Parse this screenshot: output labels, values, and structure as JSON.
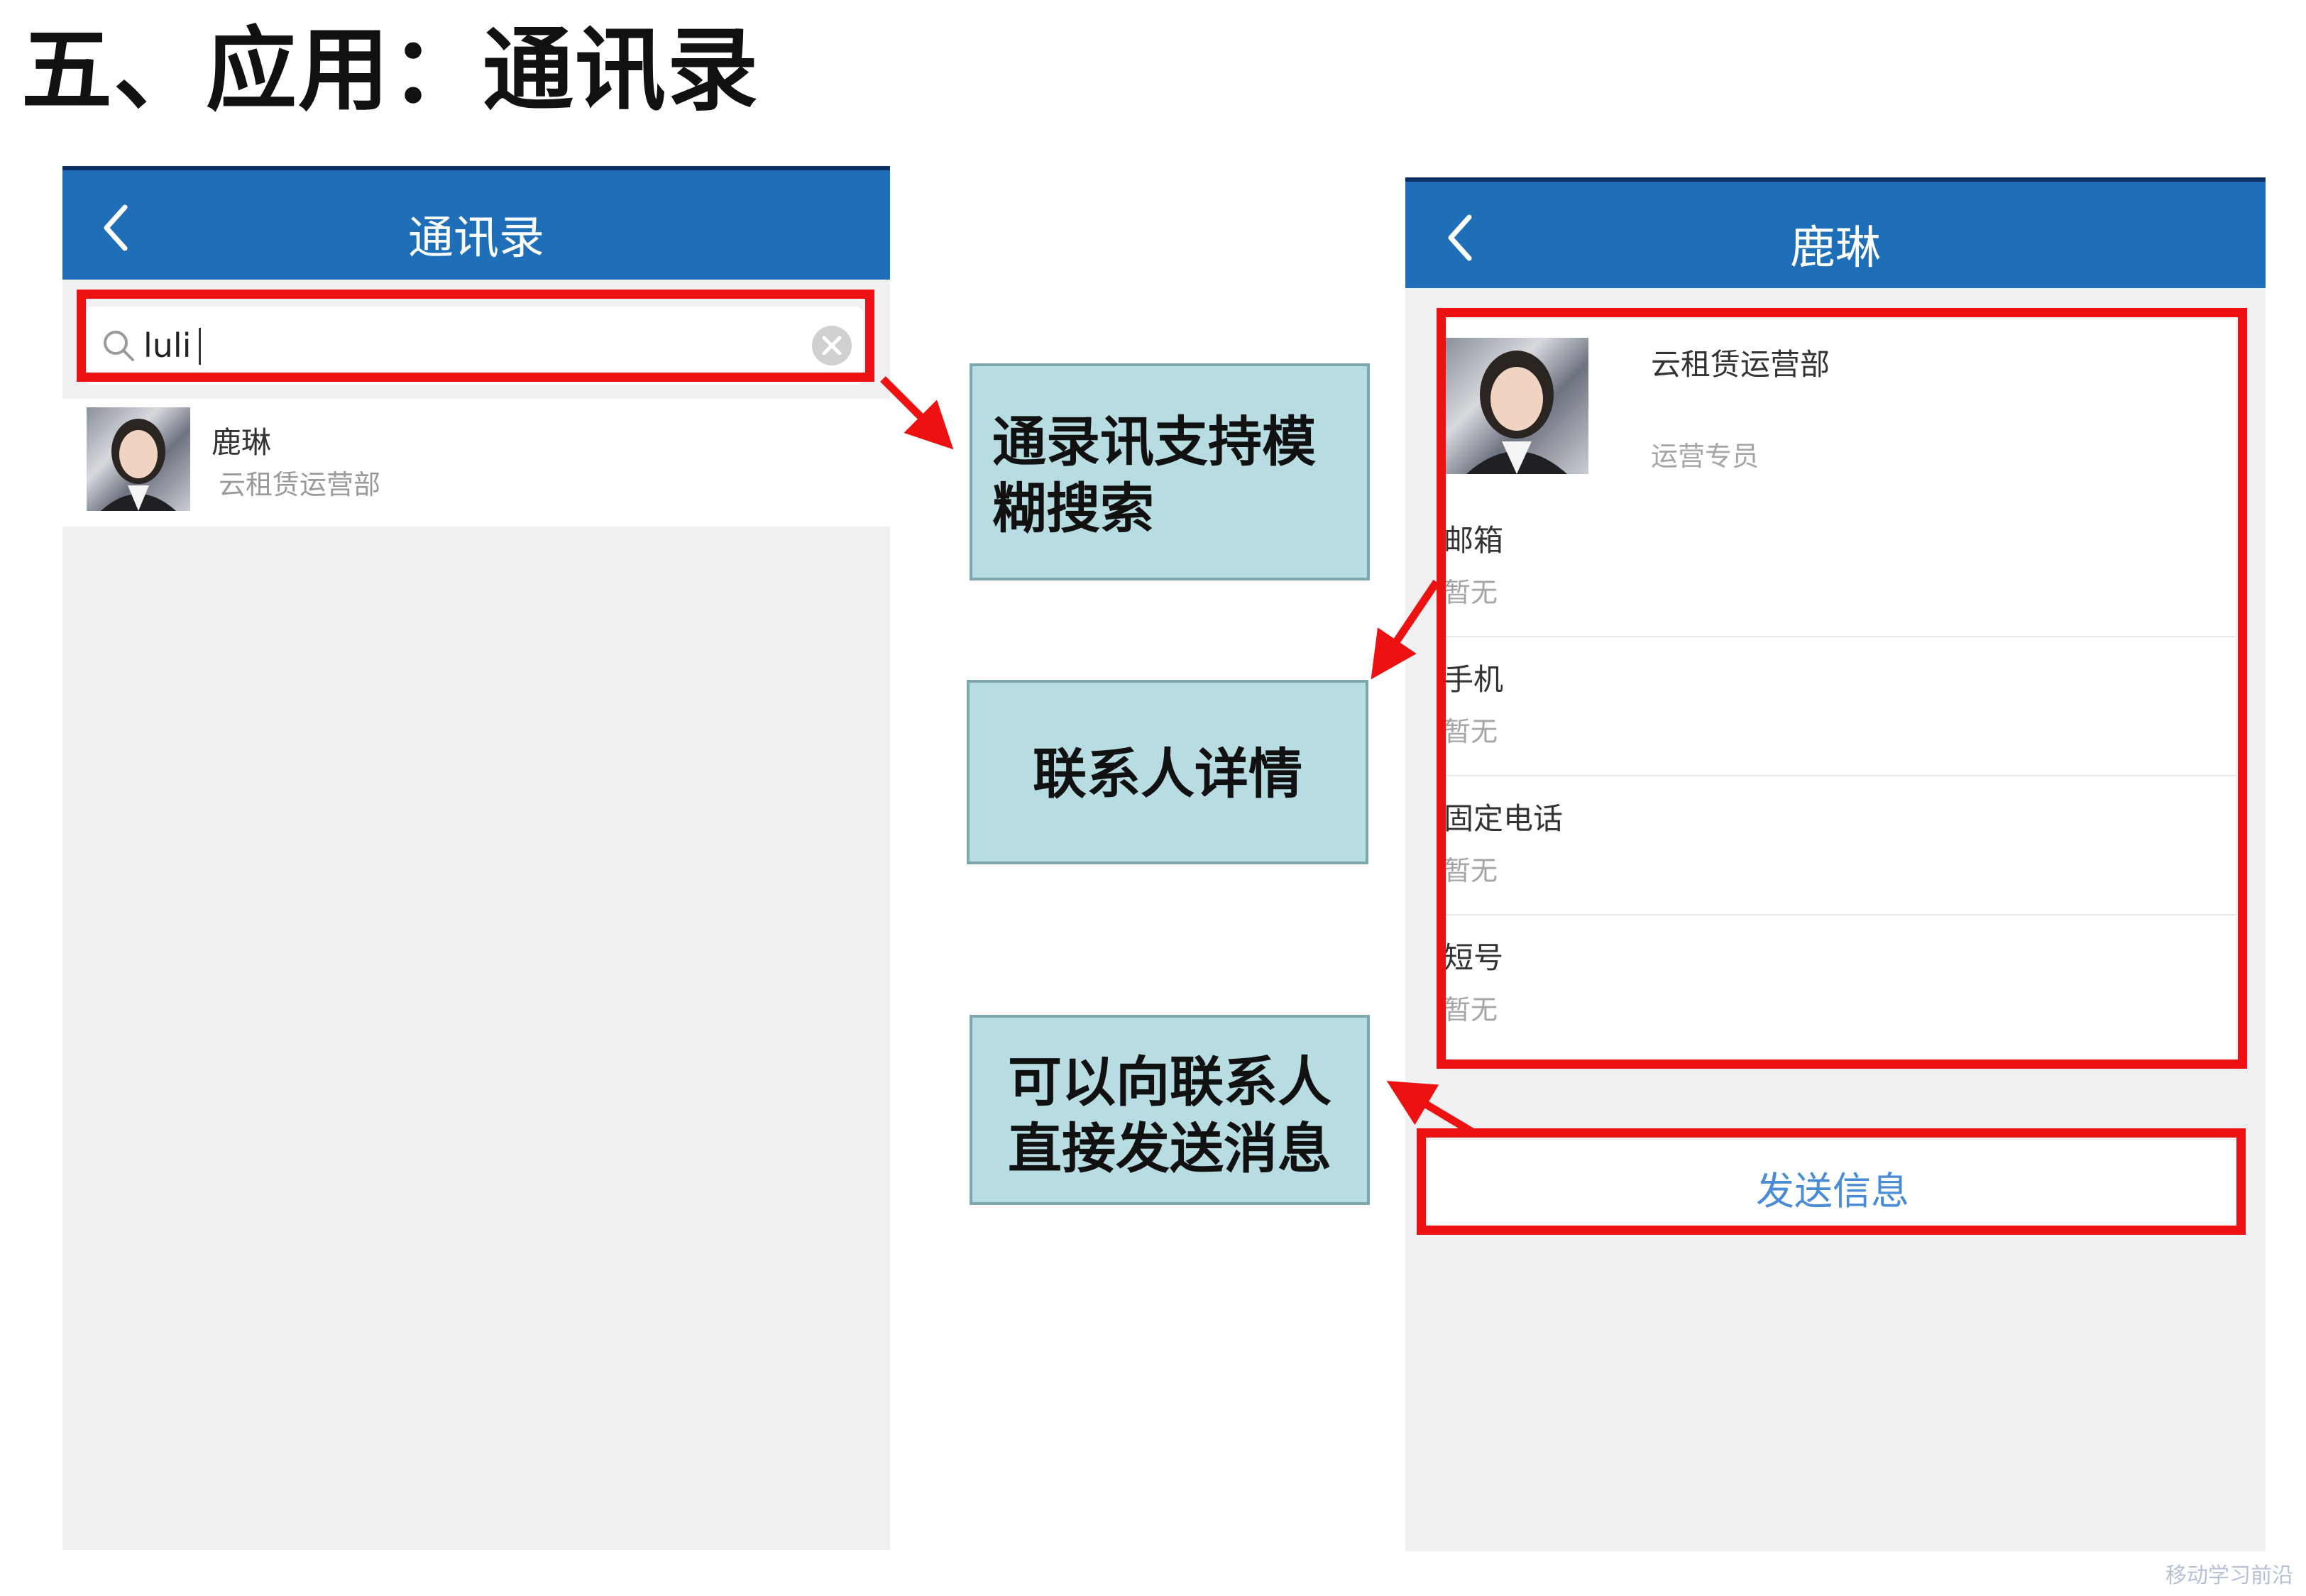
{
  "page": {
    "title": "五、应用：通讯录"
  },
  "search_screen": {
    "nav_title": "通讯录",
    "search_value": "luli",
    "result": {
      "name": "鹿琳",
      "department": "云租赁运营部"
    }
  },
  "detail_screen": {
    "nav_title": "鹿琳",
    "department": "云租赁运营部",
    "position": "运营专员",
    "fields": [
      {
        "label": "邮箱",
        "value": "暂无"
      },
      {
        "label": "手机",
        "value": "暂无"
      },
      {
        "label": "固定电话",
        "value": "暂无"
      },
      {
        "label": "短号",
        "value": "暂无"
      }
    ],
    "send_button": "发送信息"
  },
  "callouts": {
    "fuzzy_search": [
      "通录讯支持模",
      "糊搜索"
    ],
    "contact_detail": [
      "联系人详情"
    ],
    "send_message": [
      "可以向联系人",
      "直接发送消息"
    ]
  },
  "icons": {
    "back": "chevron-left-icon",
    "search": "search-icon",
    "clear": "clear-circle-icon"
  },
  "colors": {
    "nav_bar": "#1e6fb8",
    "highlight": "#ee1111",
    "callout_bg": "#b7dde3",
    "link": "#4a8bd6"
  },
  "watermark": "移动学习前沿"
}
